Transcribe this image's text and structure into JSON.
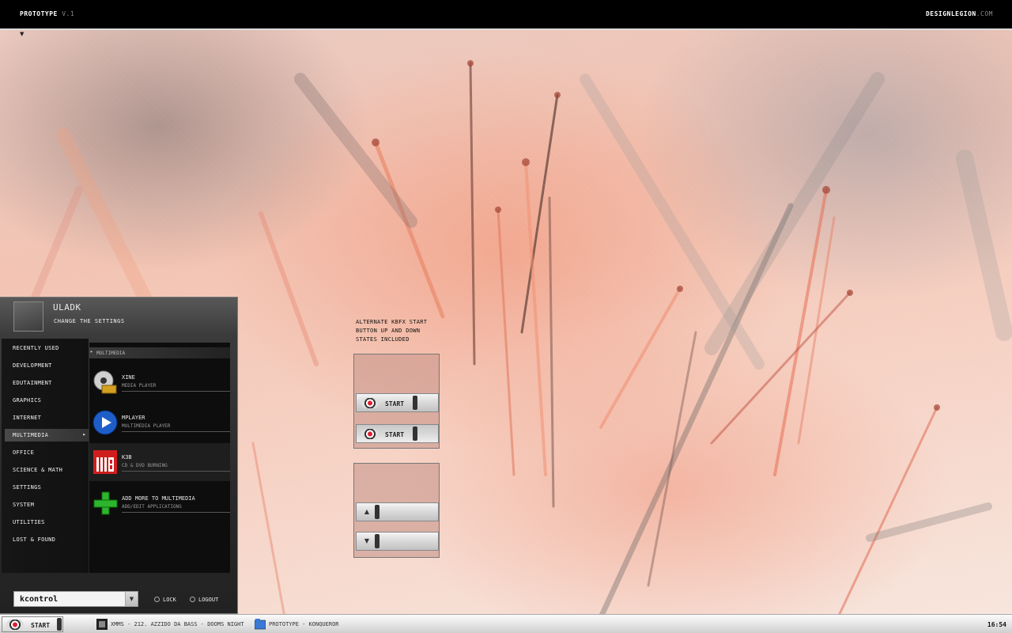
{
  "topbar": {
    "title_main": "PROTOTYPE",
    "title_version": "V.1",
    "brand_main": "DESIGNLEGION",
    "brand_suffix": ".COM"
  },
  "menu": {
    "user": "ULADK",
    "settings": "CHANGE THE SETTINGS",
    "categories": [
      "RECENTLY USED",
      "DEVELOPMENT",
      "EDUTAINMENT",
      "GRAPHICS",
      "INTERNET",
      "MULTIMEDIA",
      "OFFICE",
      "SCIENCE & MATH",
      "SETTINGS",
      "SYSTEM",
      "UTILITIES",
      "LOST & FOUND"
    ],
    "active_category": "MULTIMEDIA",
    "section_title": "MULTIMEDIA",
    "apps": [
      {
        "name": "XINE",
        "desc": "MEDIA PLAYER",
        "icon": "xine-icon"
      },
      {
        "name": "MPLAYER",
        "desc": "MULTIMEDIA PLAYER",
        "icon": "mplayer-icon"
      },
      {
        "name": "K3B",
        "desc": "CD & DVD BURNING",
        "icon": "k3b-icon"
      },
      {
        "name": "ADD MORE TO MULTIMEDIA",
        "desc": "ADD/EDIT APPLICATIONS",
        "icon": "add-icon"
      }
    ],
    "command_value": "kcontrol",
    "lock_label": "LOCK",
    "logout_label": "LOGOUT"
  },
  "note": {
    "line1": "ALTERNATE KBFX START",
    "line2": "BUTTON UP AND DOWN",
    "line3": "STATES INCLUDED"
  },
  "demo": {
    "start_label": "START",
    "up_icon": "chevron-up-icon",
    "down_icon": "chevron-down-icon"
  },
  "taskbar": {
    "start_label": "START",
    "tasks": [
      {
        "label": "XMMS - 212. AZZIDO DA BASS - DOOMS NIGHT",
        "icon": "xmms-icon"
      },
      {
        "label": "PROTOTYPE - KONQUEROR",
        "icon": "konqueror-icon"
      }
    ],
    "clock": "16:54"
  },
  "colors": {
    "menu_bg": "#2a2a2a",
    "topbar_bg": "#000000",
    "accent_red": "#dd2233"
  }
}
